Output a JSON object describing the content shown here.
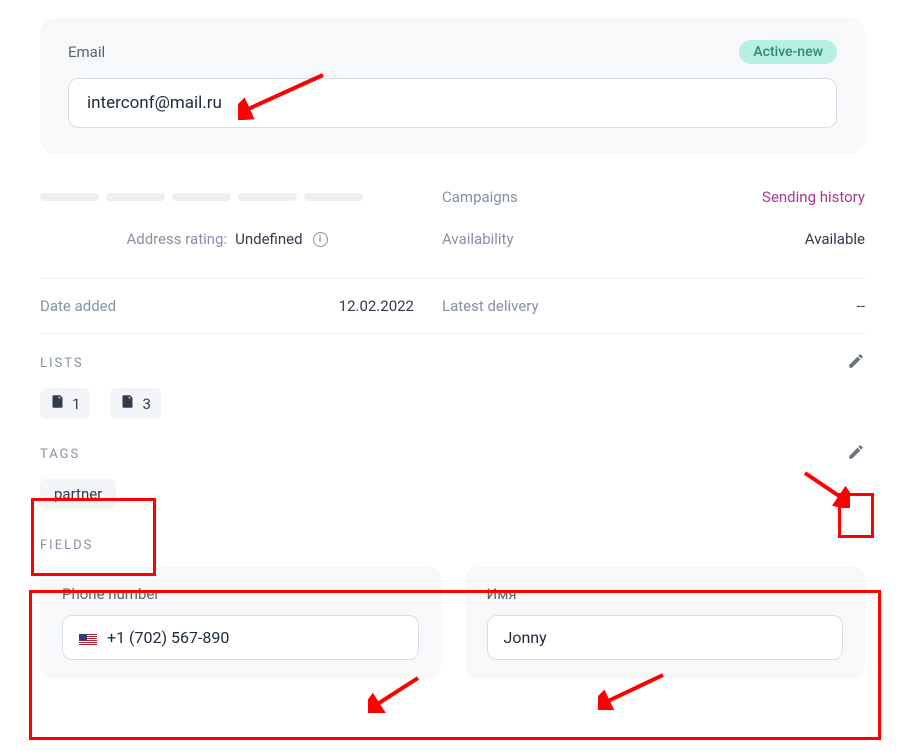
{
  "email": {
    "label": "Email",
    "value": "interconf@mail.ru",
    "status": "Active-new"
  },
  "rating": {
    "label": "Address rating:",
    "value": "Undefined"
  },
  "campaigns": {
    "label": "Campaigns",
    "link": "Sending history"
  },
  "availability": {
    "label": "Availability",
    "value": "Available"
  },
  "date_added": {
    "label": "Date added",
    "value": "12.02.2022"
  },
  "latest_delivery": {
    "label": "Latest delivery",
    "value": "--"
  },
  "lists": {
    "title": "LISTS",
    "items": [
      "1",
      "3"
    ]
  },
  "tags": {
    "title": "TAGS",
    "items": [
      "partner"
    ]
  },
  "fields": {
    "title": "FIELDS",
    "phone": {
      "label": "Phone number",
      "value": "+1 (702) 567-890"
    },
    "name": {
      "label": "Имя",
      "value": "Jonny"
    }
  }
}
